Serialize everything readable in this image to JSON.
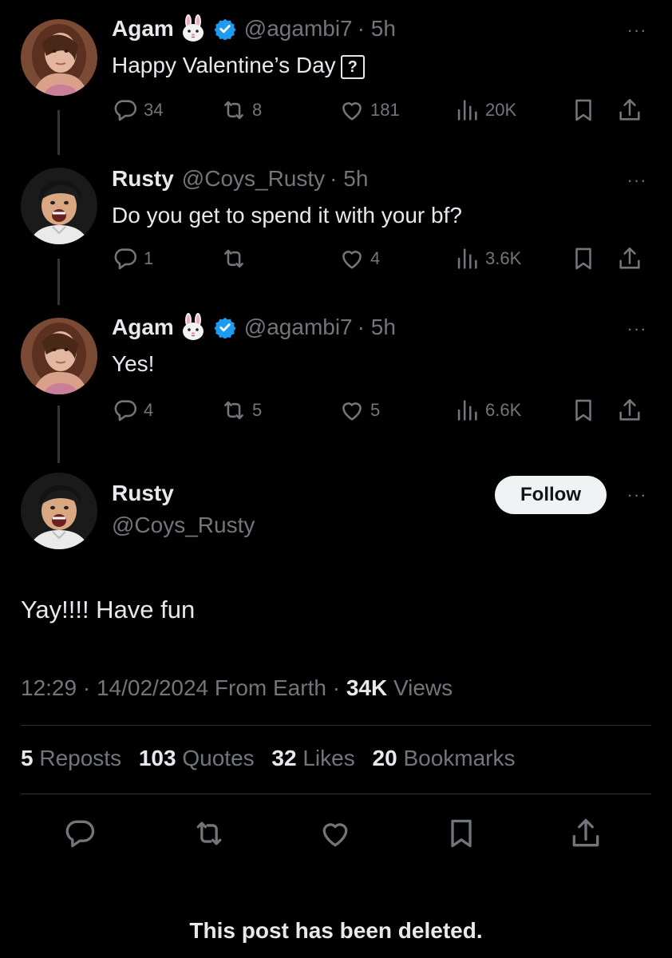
{
  "tweets": [
    {
      "name": "Agam",
      "emoji": "🐰",
      "verified": true,
      "handle": "@agambi7",
      "time": "· 5h",
      "text": "Happy Valentine’s Day",
      "text_suffix": "?",
      "replies": "34",
      "reposts": "8",
      "likes": "181",
      "views": "20K"
    },
    {
      "name": "Rusty",
      "verified": false,
      "handle": "@Coys_Rusty",
      "time": "· 5h",
      "text": "Do you get to spend it with your bf?",
      "replies": "1",
      "reposts": "",
      "likes": "4",
      "views": "3.6K"
    },
    {
      "name": "Agam",
      "emoji": "🐰",
      "verified": true,
      "handle": "@agambi7",
      "time": "· 5h",
      "text": "Yes!",
      "replies": "4",
      "reposts": "5",
      "likes": "5",
      "views": "6.6K"
    }
  ],
  "main_post": {
    "name": "Rusty",
    "handle": "@Coys_Rusty",
    "follow_label": "Follow",
    "text": "Yay!!!! Have fun",
    "time": "12:29",
    "date": "14/02/2024",
    "source": "From Earth",
    "views_count": "34K",
    "views_label": "Views",
    "stats": [
      {
        "count": "5",
        "label": "Reposts"
      },
      {
        "count": "103",
        "label": "Quotes"
      },
      {
        "count": "32",
        "label": "Likes"
      },
      {
        "count": "20",
        "label": "Bookmarks"
      }
    ]
  },
  "more_label": "···",
  "deleted_notice": "This post has been deleted.",
  "icons": {
    "reply": "reply-icon",
    "repost": "repost-icon",
    "like": "heart-icon",
    "views": "views-icon",
    "bookmark": "bookmark-icon",
    "share": "share-icon",
    "verified": "verified-badge-icon",
    "more": "more-icon"
  },
  "colors": {
    "background": "#000000",
    "text": "#e7e9ea",
    "muted": "#71767b",
    "verified": "#1d9bf0",
    "follow_bg": "#eff3f4"
  }
}
